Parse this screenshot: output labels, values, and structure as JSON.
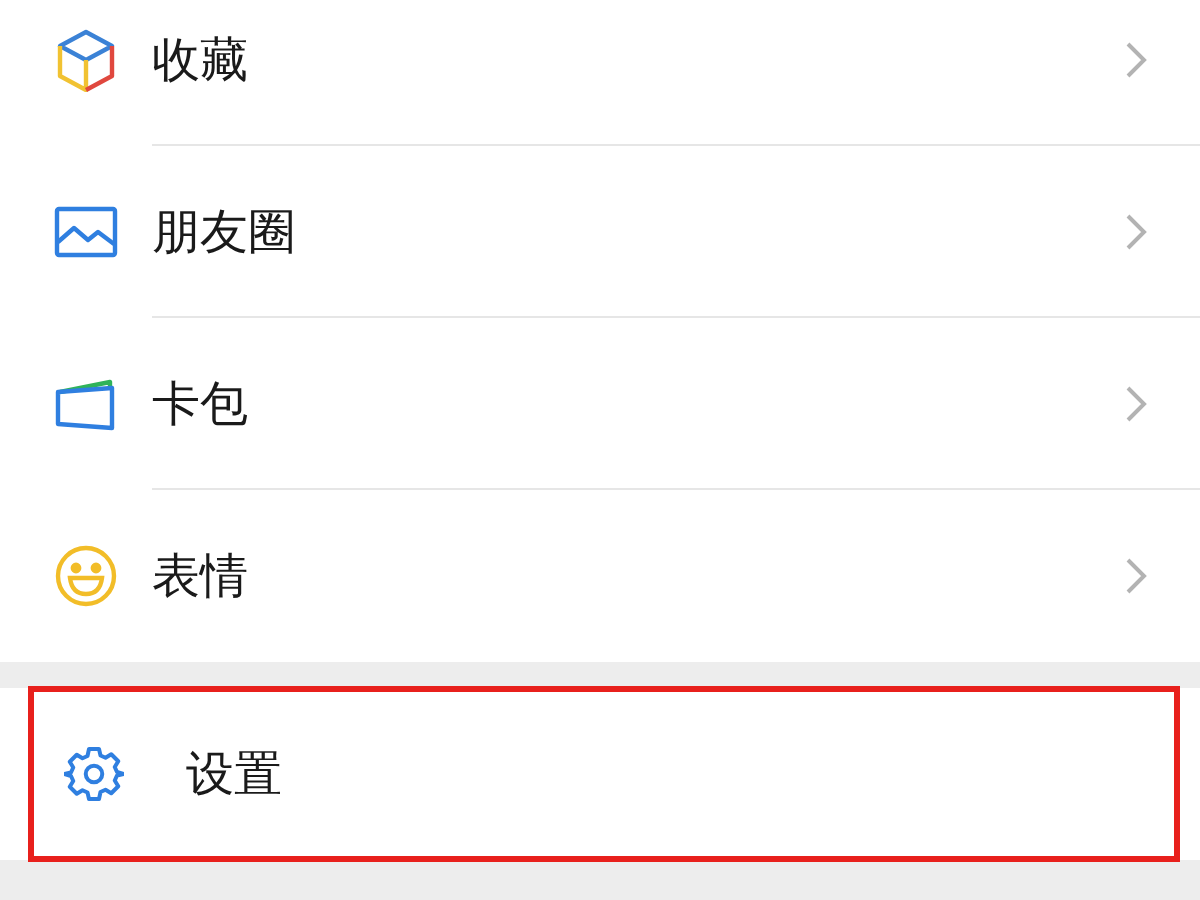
{
  "menu_groups": [
    {
      "items": [
        {
          "label": "收藏",
          "chevron": true,
          "highlighted": false
        },
        {
          "label": "朋友圈",
          "chevron": true,
          "highlighted": false
        },
        {
          "label": "卡包",
          "chevron": true,
          "highlighted": false
        },
        {
          "label": "表情",
          "chevron": true,
          "highlighted": false
        }
      ]
    },
    {
      "items": [
        {
          "label": "设置",
          "chevron": false,
          "highlighted": true
        }
      ]
    }
  ]
}
